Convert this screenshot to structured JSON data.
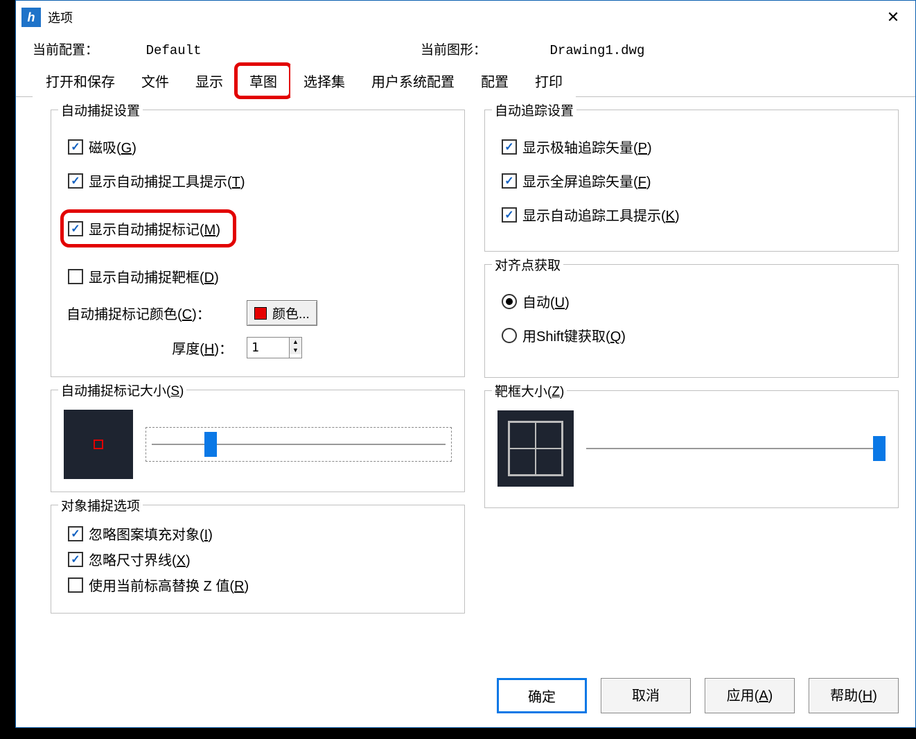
{
  "window": {
    "title": "选项",
    "close": "✕"
  },
  "header": {
    "current_profile_label": "当前配置：",
    "current_profile_value": "Default",
    "current_drawing_label": "当前图形：",
    "current_drawing_value": "Drawing1.dwg"
  },
  "tabs": {
    "open_save": "打开和保存",
    "file": "文件",
    "display": "显示",
    "sketch": "草图",
    "selection": "选择集",
    "user_system": "用户系统配置",
    "profile": "配置",
    "print": "打印"
  },
  "autosnap": {
    "group_title": "自动捕捉设置",
    "magnet": "磁吸(G)",
    "tooltip": "显示自动捕捉工具提示(T)",
    "marker": "显示自动捕捉标记(M)",
    "aperture_box": "显示自动捕捉靶框(D)",
    "color_label": "自动捕捉标记颜色(C)：",
    "color_btn": "颜色...",
    "thickness_label": "厚度(H)：",
    "thickness_value": "1"
  },
  "autotrack": {
    "group_title": "自动追踪设置",
    "polar_vector": "显示极轴追踪矢量(P)",
    "fullscreen_vector": "显示全屏追踪矢量(F)",
    "tooltip": "显示自动追踪工具提示(K)"
  },
  "align": {
    "group_title": "对齐点获取",
    "auto": "自动(U)",
    "shift": "用Shift键获取(Q)"
  },
  "marker_size": {
    "group_title": "自动捕捉标记大小(S)"
  },
  "aperture_size": {
    "group_title": "靶框大小(Z)"
  },
  "osnap_options": {
    "group_title": "对象捕捉选项",
    "ignore_hatch": "忽略图案填充对象(I)",
    "ignore_dim": "忽略尺寸界线(X)",
    "replace_z": "使用当前标高替换 Z 值(R)"
  },
  "footer": {
    "ok": "确定",
    "cancel": "取消",
    "apply": "应用(A)",
    "help": "帮助(H)"
  }
}
